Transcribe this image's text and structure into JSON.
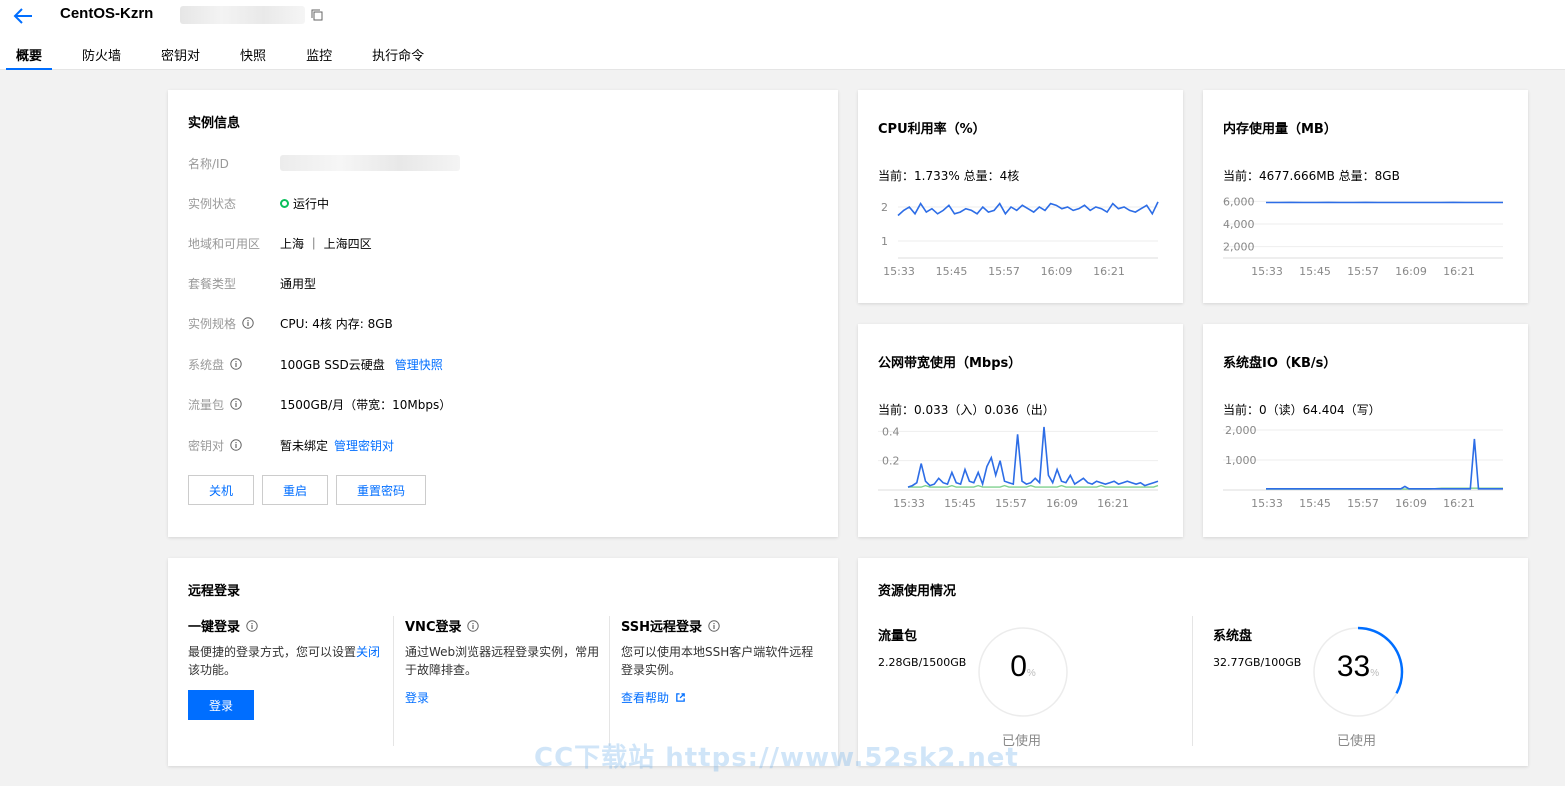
{
  "header": {
    "title": "CentOS-Kzrn",
    "tabs": [
      "概要",
      "防火墙",
      "密钥对",
      "快照",
      "监控",
      "执行命令"
    ]
  },
  "instance": {
    "title": "实例信息",
    "rows": [
      {
        "label": "名称/ID",
        "value": ""
      },
      {
        "label": "实例状态",
        "value": "运行中"
      },
      {
        "label": "地域和可用区",
        "value": "上海 ｜ 上海四区"
      },
      {
        "label": "套餐类型",
        "value": "通用型"
      },
      {
        "label": "实例规格",
        "value": "CPU: 4核 内存: 8GB"
      },
      {
        "label": "系统盘",
        "value": "100GB SSD云硬盘",
        "link": "管理快照"
      },
      {
        "label": "流量包",
        "value": "1500GB/月（带宽：10Mbps）"
      },
      {
        "label": "密钥对",
        "value": "暂未绑定",
        "link": "管理密钥对"
      }
    ],
    "buttons": [
      "关机",
      "重启",
      "重置密码"
    ]
  },
  "metrics": {
    "cpu": {
      "title": "CPU利用率（%）",
      "current": "当前：1.733% 总量：4核"
    },
    "mem": {
      "title": "内存使用量（MB）",
      "current": "当前：4677.666MB 总量：8GB"
    },
    "net": {
      "title": "公网带宽使用（Mbps）",
      "current": "当前：0.033（入）0.036（出）"
    },
    "disk": {
      "title": "系统盘IO（KB/s）",
      "current": "当前：0（读）64.404（写）"
    }
  },
  "chart_data": [
    {
      "type": "line",
      "x": [
        "15:33",
        "15:45",
        "15:57",
        "16:09",
        "16:21"
      ],
      "ylim": [
        0.5,
        2.5
      ],
      "yticks": [
        1,
        2
      ],
      "series": [
        {
          "values": [
            1.75,
            1.9,
            2.0,
            1.8,
            2.1,
            1.85,
            1.95,
            1.8,
            1.9,
            2.05,
            1.8,
            1.85,
            1.95,
            1.9,
            1.8,
            2.0,
            1.85,
            1.9,
            2.1,
            1.8,
            2.0,
            1.9,
            2.05,
            1.95,
            1.85,
            2.0,
            1.9,
            2.1,
            2.05,
            1.95,
            2.0,
            1.9,
            1.95,
            2.05,
            1.9,
            2.0,
            1.95,
            1.85,
            2.1,
            1.95,
            2.0,
            1.9,
            1.85,
            1.95,
            2.05,
            1.8,
            2.15
          ]
        }
      ],
      "color": "#2d6de6"
    },
    {
      "type": "line",
      "x": [
        "15:33",
        "15:45",
        "15:57",
        "16:09",
        "16:21"
      ],
      "ylim": [
        1000,
        7000
      ],
      "yticks": [
        "2,000",
        "4,000",
        "6,000"
      ],
      "series": [
        {
          "values": [
            5900,
            5900,
            5905,
            5900,
            5900,
            5902,
            5900,
            5900,
            5905,
            5900,
            5900,
            5900,
            5898,
            5900,
            5900,
            5902,
            5900,
            5900,
            5900,
            5900
          ]
        }
      ],
      "color": "#2d6de6"
    },
    {
      "type": "line",
      "x": [
        "15:33",
        "15:45",
        "15:57",
        "16:09",
        "16:21"
      ],
      "ylim": [
        0,
        0.45
      ],
      "yticks": [
        "0.2",
        "0.4"
      ],
      "series": [
        {
          "values": [
            0.02,
            0.03,
            0.05,
            0.18,
            0.06,
            0.03,
            0.04,
            0.08,
            0.05,
            0.04,
            0.12,
            0.05,
            0.04,
            0.14,
            0.06,
            0.05,
            0.12,
            0.04,
            0.16,
            0.22,
            0.1,
            0.2,
            0.06,
            0.05,
            0.04,
            0.38,
            0.06,
            0.04,
            0.05,
            0.08,
            0.05,
            0.43,
            0.1,
            0.05,
            0.14,
            0.06,
            0.05,
            0.1,
            0.04,
            0.06,
            0.08,
            0.05,
            0.04,
            0.06,
            0.05,
            0.04,
            0.05,
            0.06,
            0.04,
            0.05,
            0.06,
            0.05,
            0.04,
            0.05,
            0.03,
            0.04,
            0.05,
            0.06
          ]
        },
        {
          "values": [
            0.02,
            0.02,
            0.02,
            0.02,
            0.03,
            0.02,
            0.02,
            0.02,
            0.02,
            0.02,
            0.03,
            0.02,
            0.02,
            0.02,
            0.02,
            0.02,
            0.03,
            0.02,
            0.02,
            0.02,
            0.02,
            0.02,
            0.03,
            0.02,
            0.02,
            0.02,
            0.02,
            0.02,
            0.03,
            0.02,
            0.02,
            0.02,
            0.02,
            0.02,
            0.02,
            0.03,
            0.02,
            0.02,
            0.02,
            0.02,
            0.02,
            0.02,
            0.02,
            0.02,
            0.03,
            0.02,
            0.02,
            0.02,
            0.02,
            0.02,
            0.02,
            0.02,
            0.02,
            0.02,
            0.02,
            0.02,
            0.02,
            0.03
          ]
        }
      ],
      "colors": [
        "#2d6de6",
        "#7fd18e"
      ]
    },
    {
      "type": "line",
      "x": [
        "15:33",
        "15:45",
        "15:57",
        "16:09",
        "16:21"
      ],
      "ylim": [
        0,
        2200
      ],
      "yticks": [
        "1,000",
        "2,000"
      ],
      "series": [
        {
          "values": [
            40,
            40,
            40,
            40,
            40,
            40,
            40,
            40,
            40,
            40,
            40,
            40,
            40,
            40,
            40,
            40,
            40,
            40,
            40,
            40,
            40,
            40,
            40,
            40,
            40,
            40,
            40,
            40,
            40,
            40,
            40,
            40,
            40,
            40,
            120,
            40,
            40,
            40,
            40,
            40,
            40,
            40,
            40,
            40,
            40,
            40,
            40,
            40,
            40,
            40,
            40,
            1700,
            40,
            40,
            40,
            40,
            40,
            40,
            40
          ]
        },
        {
          "values": [
            30,
            30,
            30,
            30,
            30,
            30,
            30,
            30,
            30,
            30,
            30,
            30,
            30,
            30,
            30,
            30,
            30,
            30,
            30,
            30,
            30,
            30,
            30,
            30,
            30,
            30,
            30,
            30,
            30,
            30,
            30,
            30,
            30,
            30,
            30,
            30,
            30,
            30,
            30,
            30,
            30,
            40,
            50,
            60,
            60,
            60,
            60,
            60,
            60,
            60,
            60,
            60,
            60,
            60,
            60,
            60,
            60,
            60,
            60
          ]
        }
      ],
      "colors": [
        "#2d6de6",
        "#7fd18e"
      ]
    }
  ],
  "remote": {
    "title": "远程登录",
    "cols": [
      {
        "title": "一键登录",
        "desc": "最便捷的登录方式，您可以设置",
        "desc_link": "关闭",
        "desc2": "该功能。",
        "action": "登录"
      },
      {
        "title": "VNC登录",
        "desc": "通过Web浏览器远程登录实例，常用于故障排查。",
        "action": "登录"
      },
      {
        "title": "SSH远程登录",
        "desc": "您可以使用本地SSH客户端软件远程登录实例。",
        "action": "查看帮助"
      }
    ]
  },
  "resources": {
    "title": "资源使用情况",
    "traffic": {
      "label": "流量包",
      "value": "2.28GB/1500GB",
      "percent": "0",
      "percent_num": 0,
      "caption": "已使用",
      "unit": "%"
    },
    "disk": {
      "label": "系统盘",
      "value": "32.77GB/100GB",
      "percent": "33",
      "percent_num": 33,
      "caption": "已使用",
      "unit": "%"
    }
  },
  "watermark": "CC下载站 https://www.52sk2.net",
  "colors": {
    "accent": "#006eff",
    "success": "#0abf5b",
    "line": "#2d6de6",
    "line2": "#7fd18e"
  }
}
